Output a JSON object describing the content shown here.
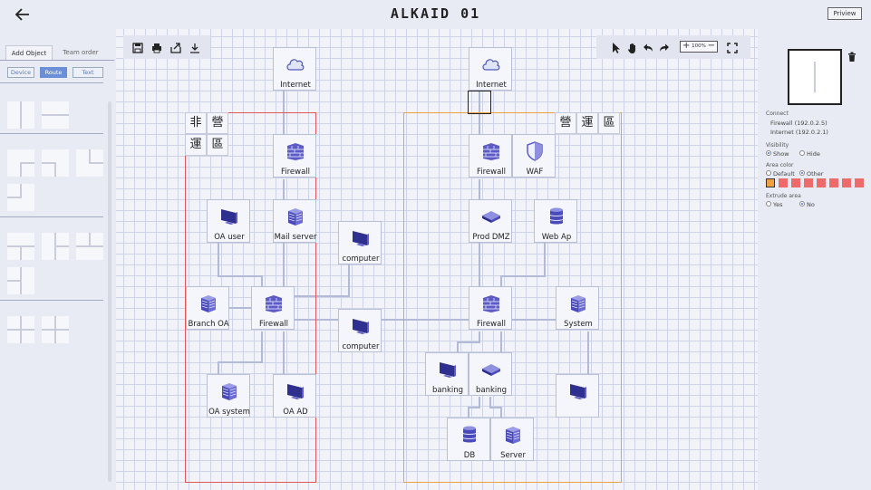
{
  "app": {
    "logo": "ALKAID 01",
    "preview_label": "Priview"
  },
  "left_panel": {
    "tabs": [
      {
        "label": "Add Object",
        "active": true
      },
      {
        "label": "Team order",
        "active": false
      }
    ],
    "subtabs": [
      {
        "label": "Device",
        "active": false
      },
      {
        "label": "Route",
        "active": true
      },
      {
        "label": "Text",
        "active": false
      }
    ]
  },
  "toolbar": {
    "left_icons": [
      "save-icon",
      "print-icon",
      "export-icon",
      "download-icon"
    ],
    "right_icons": [
      "pointer-icon",
      "hand-icon",
      "undo-icon",
      "redo-icon",
      "zoom-in-icon",
      "zoom-out-icon",
      "fullscreen-icon"
    ],
    "zoom_level": "100%"
  },
  "areas": [
    {
      "name": "left-area",
      "label_chars": [
        "非",
        "營",
        "運",
        "區"
      ],
      "color": "#e05858"
    },
    {
      "name": "right-area",
      "label_chars": [
        "營",
        "運",
        "區"
      ],
      "color": "#f0a040"
    }
  ],
  "nodes": [
    {
      "id": "internet-l",
      "label": "Internet",
      "icon": "cloud-icon"
    },
    {
      "id": "firewall-l",
      "label": "Firewall",
      "icon": "firewall-icon"
    },
    {
      "id": "oa-user",
      "label": "OA user",
      "icon": "monitor-icon"
    },
    {
      "id": "mail-server",
      "label": "Mail server",
      "icon": "server-icon"
    },
    {
      "id": "computer-1",
      "label": "computer",
      "icon": "monitor-icon"
    },
    {
      "id": "branch-oa",
      "label": "Branch OA",
      "icon": "server-icon"
    },
    {
      "id": "firewall-l2",
      "label": "Firewall",
      "icon": "firewall-icon"
    },
    {
      "id": "computer-2",
      "label": "computer",
      "icon": "monitor-icon"
    },
    {
      "id": "oa-system",
      "label": "OA system",
      "icon": "server-icon"
    },
    {
      "id": "oa-ad",
      "label": "OA AD",
      "icon": "monitor-icon"
    },
    {
      "id": "internet-r",
      "label": "Internet",
      "icon": "cloud-icon"
    },
    {
      "id": "firewall-r",
      "label": "Firewall",
      "icon": "firewall-icon"
    },
    {
      "id": "waf",
      "label": "WAF",
      "icon": "shield-icon"
    },
    {
      "id": "prod-dmz",
      "label": "Prod DMZ",
      "icon": "switch-icon"
    },
    {
      "id": "web-ap",
      "label": "Web Ap",
      "icon": "database-icon"
    },
    {
      "id": "firewall-r2",
      "label": "Firewall",
      "icon": "firewall-icon"
    },
    {
      "id": "system",
      "label": "System",
      "icon": "server-icon"
    },
    {
      "id": "banking-1",
      "label": "banking",
      "icon": "monitor-icon"
    },
    {
      "id": "banking-2",
      "label": "banking",
      "icon": "switch-icon"
    },
    {
      "id": "monitor-r",
      "label": "",
      "icon": "monitor-icon"
    },
    {
      "id": "db",
      "label": "DB",
      "icon": "database-icon"
    },
    {
      "id": "server",
      "label": "Server",
      "icon": "server-icon"
    }
  ],
  "right_panel": {
    "connect_title": "Connect",
    "connections": [
      "Firewall  (192.0.2.5)",
      "Internet  (192.0.2.1)"
    ],
    "visibility_title": "Visibility",
    "visibility_options": [
      {
        "label": "Show",
        "selected": true
      },
      {
        "label": "Hide",
        "selected": false
      }
    ],
    "area_color_title": "Area color",
    "area_color_options": [
      {
        "label": "Default",
        "selected": false
      },
      {
        "label": "Other",
        "selected": true
      }
    ],
    "swatches": [
      "#f0a040",
      "#ee6b6b",
      "#ee6b6b",
      "#ee6b6b",
      "#ee6b6b",
      "#ee6b6b",
      "#ee6b6b",
      "#ee6b6b"
    ],
    "extrude_title": "Extrude area",
    "extrude_options": [
      {
        "label": "Yes",
        "selected": false
      },
      {
        "label": "No",
        "selected": true
      }
    ]
  }
}
